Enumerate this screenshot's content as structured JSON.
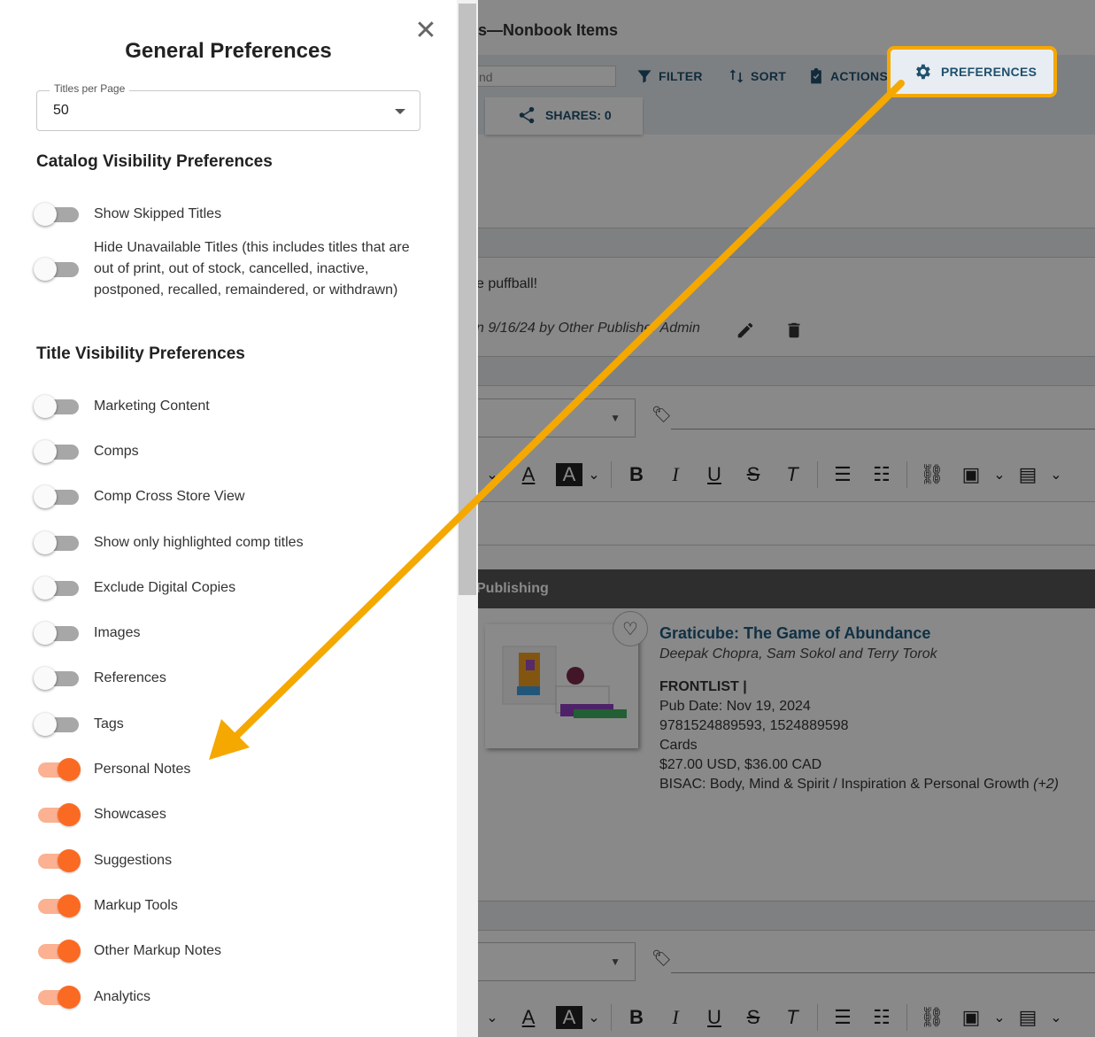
{
  "page": {
    "title": "s—Nonbook Items",
    "search_placeholder": "nd",
    "toolbar": {
      "filter": "FILTER",
      "sort": "SORT",
      "actions": "ACTIONS",
      "preferences": "PREFERENCES"
    },
    "shares": "SHARES: 0",
    "note_text": "e puffball!",
    "note_meta": "n 9/16/24 by Other Publisher Admin",
    "publisher_bar": "Publishing",
    "book": {
      "title": "Graticube: The Game of Abundance",
      "authors": "Deepak Chopra, Sam Sokol and Terry Torok",
      "list": "FRONTLIST |",
      "pub_date": "Pub Date: Nov 19, 2024",
      "isbns": "9781524889593, 1524889598",
      "format": "Cards",
      "price": "$27.00 USD, $36.00 CAD",
      "bisac": "BISAC: Body, Mind & Spirit / Inspiration & Personal Growth",
      "bisac_more": "(+2)"
    }
  },
  "drawer": {
    "title": "General Preferences",
    "titles_per_page": {
      "label": "Titles per Page",
      "value": "50"
    },
    "catalog_heading": "Catalog Visibility Preferences",
    "catalog": [
      {
        "label": "Show Skipped Titles",
        "on": false
      },
      {
        "label": "Hide Unavailable Titles (this includes titles that are out of print, out of stock, cancelled, inactive, postponed, recalled, remaindered, or withdrawn)",
        "on": false
      }
    ],
    "title_heading": "Title Visibility Preferences",
    "title_prefs": [
      {
        "label": "Marketing Content",
        "on": false
      },
      {
        "label": "Comps",
        "on": false
      },
      {
        "label": "Comp Cross Store View",
        "on": false
      },
      {
        "label": "Show only highlighted comp titles",
        "on": false
      },
      {
        "label": "Exclude Digital Copies",
        "on": false
      },
      {
        "label": "Images",
        "on": false
      },
      {
        "label": "References",
        "on": false
      },
      {
        "label": "Tags",
        "on": false
      },
      {
        "label": "Personal Notes",
        "on": true
      },
      {
        "label": "Showcases",
        "on": true
      },
      {
        "label": "Suggestions",
        "on": true
      },
      {
        "label": "Markup Tools",
        "on": true
      },
      {
        "label": "Other Markup Notes",
        "on": true
      },
      {
        "label": "Analytics",
        "on": true
      }
    ]
  },
  "colors": {
    "accent_orange": "#fb6a22",
    "highlight": "#f5a800",
    "link_blue": "#20506e"
  }
}
